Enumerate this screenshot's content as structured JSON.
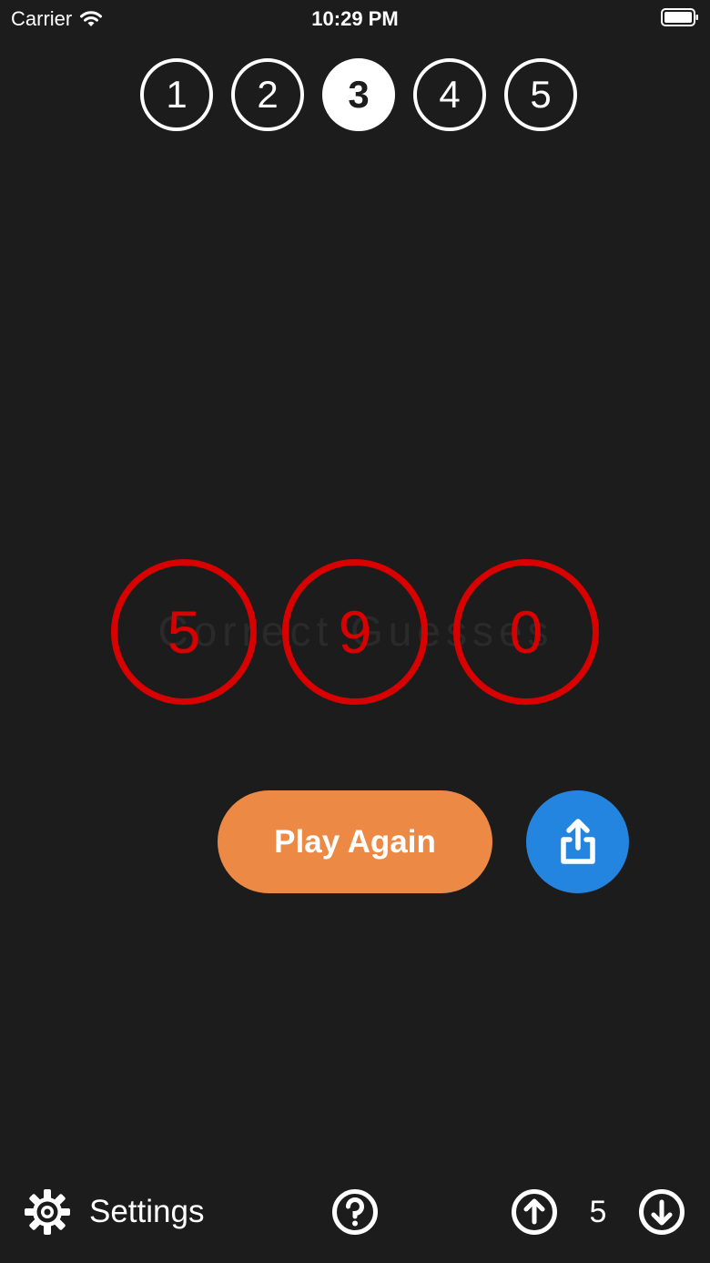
{
  "status_bar": {
    "carrier": "Carrier",
    "time": "10:29 PM"
  },
  "levels": {
    "items": [
      "1",
      "2",
      "3",
      "4",
      "5"
    ],
    "selected": "3"
  },
  "result": {
    "digits": [
      "5",
      "9",
      "0"
    ],
    "background_word": "Correct Guesses",
    "digit_color": "#d90000"
  },
  "actions": {
    "play_again_label": "Play Again",
    "play_again_color": "#ec8944",
    "share_icon": "share-icon",
    "share_color": "#2385e0"
  },
  "bottom_bar": {
    "settings_label": "Settings",
    "settings_icon": "gear-icon",
    "help_icon": "question-circle-icon",
    "count_up_icon": "arrow-up-circle-icon",
    "count_value": "5",
    "count_down_icon": "arrow-down-circle-icon"
  }
}
